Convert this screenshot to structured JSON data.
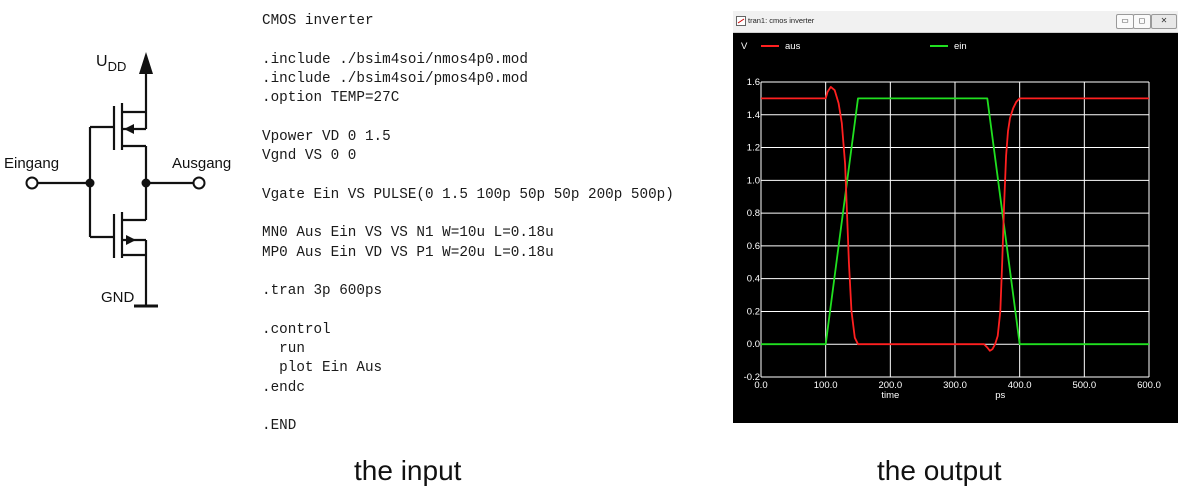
{
  "schematic": {
    "supply_label": "U",
    "supply_subscript": "DD",
    "input_label": "Eingang",
    "output_label": "Ausgang",
    "ground_label": "GND"
  },
  "netlist": {
    "lines": [
      "CMOS inverter",
      "",
      ".include ./bsim4soi/nmos4p0.mod",
      ".include ./bsim4soi/pmos4p0.mod",
      ".option TEMP=27C",
      "",
      "Vpower VD 0 1.5",
      "Vgnd VS 0 0",
      "",
      "Vgate Ein VS PULSE(0 1.5 100p 50p 50p 200p 500p)",
      "",
      "MN0 Aus Ein VS VS N1 W=10u L=0.18u",
      "MP0 Aus Ein VD VS P1 W=20u L=0.18u",
      "",
      ".tran 3p 600ps",
      "",
      ".control",
      "  run",
      "  plot Ein Aus",
      ".endc",
      "",
      ".END"
    ]
  },
  "captions": {
    "input": "the input",
    "output": "the output"
  },
  "window": {
    "title": "tran1: cmos inverter",
    "min_glyph": "▭",
    "max_glyph": "◻",
    "close_glyph": "✕"
  },
  "colors": {
    "aus": "#ff2020",
    "ein": "#20e020",
    "plot_bg": "#000000",
    "grid": "#ffffff"
  },
  "chart_data": {
    "type": "line",
    "ylabel": "V",
    "x_axis_labels": [
      "time",
      "ps"
    ],
    "xlim": [
      0,
      600
    ],
    "ylim": [
      -0.2,
      1.6
    ],
    "x_ticks": [
      0,
      100,
      200,
      300,
      400,
      500,
      600
    ],
    "x_tick_labels": [
      "0.0",
      "100.0",
      "200.0",
      "300.0",
      "400.0",
      "500.0",
      "600.0"
    ],
    "y_ticks": [
      -0.2,
      0,
      0.2,
      0.4,
      0.6,
      0.8,
      1.0,
      1.2,
      1.4,
      1.6
    ],
    "y_tick_labels": [
      "-0.2",
      "0.0",
      "0.2",
      "0.4",
      "0.6",
      "0.8",
      "1.0",
      "1.2",
      "1.4",
      "1.6"
    ],
    "grid": true,
    "legend_position": "top",
    "series": [
      {
        "name": "aus",
        "color": "#ff2020",
        "x": [
          0,
          100,
          103,
          108,
          114,
          120,
          125,
          130,
          133,
          136,
          140,
          145,
          150,
          155,
          160,
          180,
          250,
          340,
          345,
          350,
          354,
          358,
          362,
          366,
          370,
          373,
          376,
          379,
          382,
          385,
          390,
          395,
          400,
          410,
          450,
          600
        ],
        "y": [
          1.5,
          1.5,
          1.54,
          1.57,
          1.55,
          1.47,
          1.35,
          1.1,
          0.8,
          0.5,
          0.2,
          0.04,
          0.0,
          0.0,
          0.0,
          0.0,
          0.0,
          0.0,
          0.0,
          -0.02,
          -0.04,
          -0.03,
          0.0,
          0.05,
          0.2,
          0.5,
          0.85,
          1.15,
          1.3,
          1.38,
          1.44,
          1.48,
          1.5,
          1.5,
          1.5,
          1.5
        ]
      },
      {
        "name": "ein",
        "color": "#20e020",
        "x": [
          0,
          100,
          150,
          350,
          400,
          600
        ],
        "y": [
          0,
          0,
          1.5,
          1.5,
          0,
          0
        ]
      }
    ]
  }
}
